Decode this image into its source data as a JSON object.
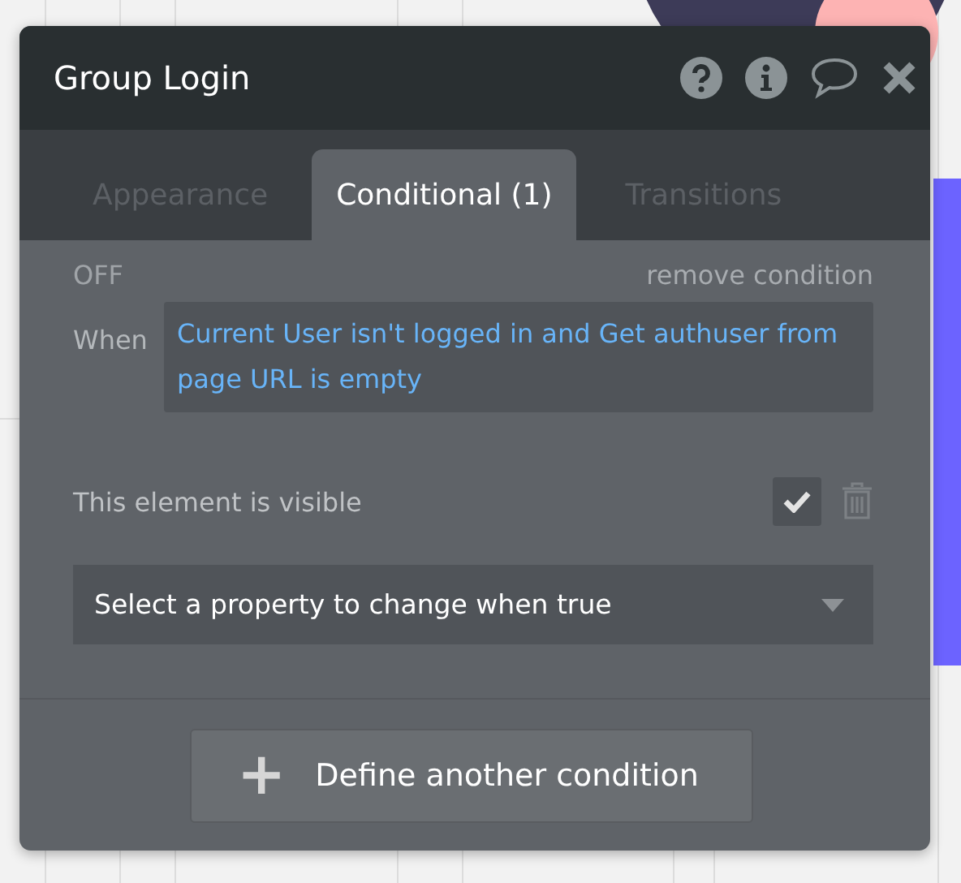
{
  "panel": {
    "title": "Group Login"
  },
  "tabs": [
    {
      "label": "Appearance",
      "selected": false
    },
    {
      "label": "Conditional (1)",
      "selected": true
    },
    {
      "label": "Transitions",
      "selected": false
    }
  ],
  "condition": {
    "status": "OFF",
    "remove": "remove condition",
    "when_label": "When",
    "expression": "Current User isn't logged in and Get authuser from page URL is empty",
    "properties": [
      {
        "label": "This element is visible",
        "checked": true
      }
    ],
    "select": {
      "value": "Select a property to change when true"
    }
  },
  "add_button": {
    "icon": "+",
    "label": "Define another condition"
  }
}
